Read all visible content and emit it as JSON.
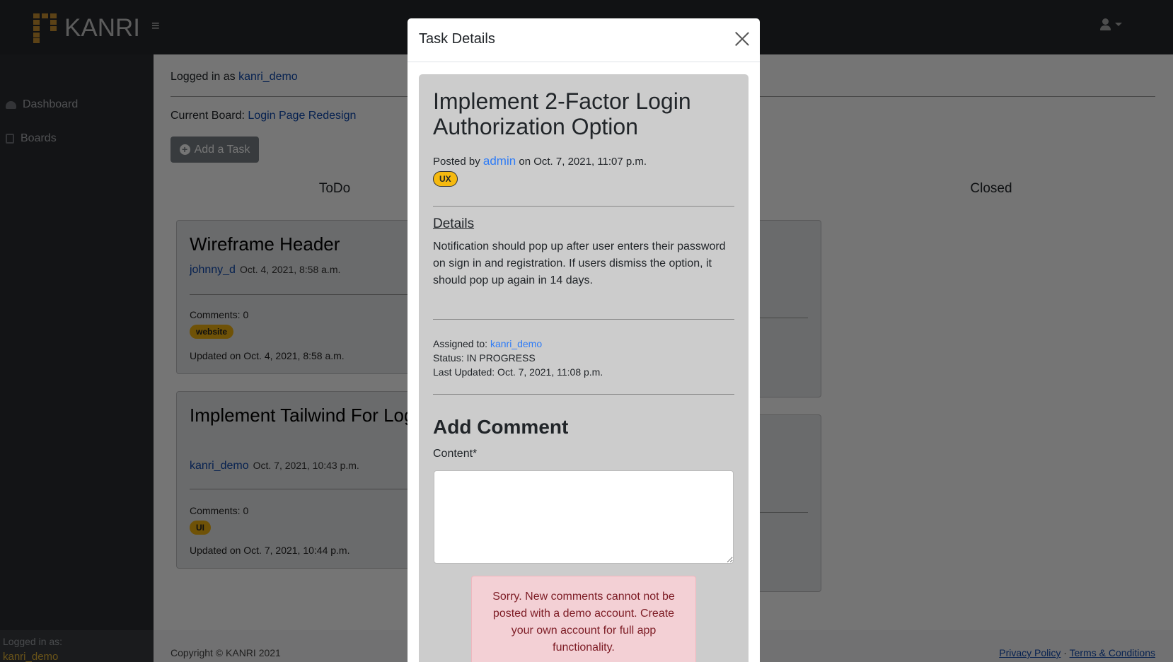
{
  "navbar": {
    "brand": "KANRI",
    "menu_icon": "hamburger-icon",
    "user_icon": "user-icon"
  },
  "sidebar": {
    "items": [
      {
        "label": "Dashboard",
        "icon": "dashboard-icon"
      },
      {
        "label": "Boards",
        "icon": "boards-icon"
      }
    ],
    "footer_label": "Logged in as:",
    "footer_user": "kanri_demo"
  },
  "main": {
    "logged_in_prefix": "Logged in as",
    "logged_in_user": "kanri_demo",
    "board_prefix": "Current Board:",
    "board_name": "Login Page Redesign",
    "add_task": "Add a Task",
    "columns": [
      {
        "title": "ToDo"
      },
      {
        "title": ""
      },
      {
        "title": "Closed"
      }
    ],
    "todo_cards": [
      {
        "title": "Wireframe Header",
        "author": "johnny_d",
        "date": "Oct. 4, 2021, 8:58 a.m.",
        "comments": "Comments: 0",
        "tag": "website",
        "updated": "Updated on Oct. 4, 2021, 8:58 a.m."
      },
      {
        "title": "Implement Tailwind For Login Form",
        "author": "kanri_demo",
        "date": "Oct. 7, 2021, 10:43 p.m.",
        "comments": "Comments: 0",
        "tag": "UI",
        "updated": "Updated on Oct. 7, 2021, 10:44 p.m."
      }
    ]
  },
  "footer": {
    "copyright": "Copyright © KANRI 2021",
    "privacy": "Privacy Policy",
    "sep": "·",
    "terms": "Terms & Conditions"
  },
  "modal": {
    "title": "Task Details",
    "task_title": "Implement 2-Factor Login Authorization Option",
    "posted_prefix": "Posted by",
    "posted_by": "admin",
    "posted_on": "on Oct. 7, 2021, 11:07 p.m.",
    "tag": "UX",
    "details_heading": "Details",
    "details": "Notification should pop up after user enters their password on sign in and registration. If users dismiss the option, it should pop up again in 14 days.",
    "assigned_prefix": "Assigned to:",
    "assigned_to": "kanri_demo",
    "status": "Status: IN PROGRESS",
    "last_updated": "Last Updated: Oct. 7, 2021, 11:08 p.m.",
    "add_comment": "Add Comment",
    "content_label": "Content*",
    "content_value": "",
    "alert": "Sorry. New comments cannot not be posted with a demo account. Create your own account for full app functionality."
  },
  "colors": {
    "brand": "#c9902f",
    "tag": "#f1b20f",
    "link": "#2f7cf6",
    "alert_bg": "#f3d0d5",
    "alert_text": "#7d1c25"
  }
}
